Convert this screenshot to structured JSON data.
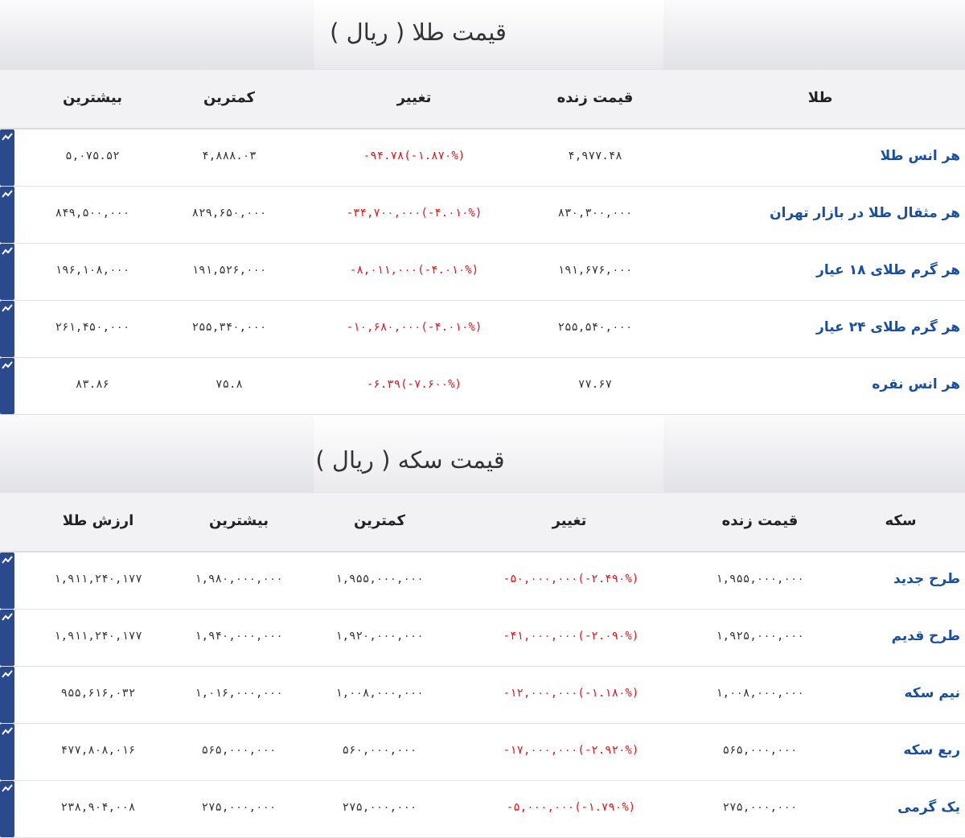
{
  "gold": {
    "title": "قیمت طلا ( ریال )",
    "headers": {
      "name": "طلا",
      "live": "قیمت زنده",
      "change": "تغییر",
      "low": "کمترین",
      "high": "بیشترین"
    },
    "rows": [
      {
        "name": "هر انس طلا",
        "live": "۴,۹۷۷.۴۸",
        "change": "-۹۴.۷۸(-۱.۸۷۰%)",
        "low": "۴,۸۸۸.۰۳",
        "high": "۵,۰۷۵.۵۲"
      },
      {
        "name": "هر مثقال طلا در بازار تهران",
        "live": "۸۳۰,۳۰۰,۰۰۰",
        "change": "-۳۴,۷۰۰,۰۰۰(-۴.۰۱۰%)",
        "low": "۸۲۹,۶۵۰,۰۰۰",
        "high": "۸۴۹,۵۰۰,۰۰۰"
      },
      {
        "name": "هر گرم طلای ۱۸ عیار",
        "live": "۱۹۱,۶۷۶,۰۰۰",
        "change": "-۸,۰۱۱,۰۰۰(-۴.۰۱۰%)",
        "low": "۱۹۱,۵۲۶,۰۰۰",
        "high": "۱۹۶,۱۰۸,۰۰۰"
      },
      {
        "name": "هر گرم طلای ۲۴ عیار",
        "live": "۲۵۵,۵۴۰,۰۰۰",
        "change": "-۱۰,۶۸۰,۰۰۰(-۴.۰۱۰%)",
        "low": "۲۵۵,۳۴۰,۰۰۰",
        "high": "۲۶۱,۴۵۰,۰۰۰"
      },
      {
        "name": "هر انس نقره",
        "live": "۷۷.۶۷",
        "change": "-۶.۳۹(-۷.۶۰۰%)",
        "low": "۷۵.۸",
        "high": "۸۳.۸۶"
      }
    ]
  },
  "coin": {
    "title": "قیمت سکه ( ریال )",
    "headers": {
      "name": "سکه",
      "live": "قیمت زنده",
      "change": "تغییر",
      "low": "کمترین",
      "high": "بیشترین",
      "gold_value": "ارزش طلا"
    },
    "rows": [
      {
        "name": "طرح جدید",
        "live": "۱,۹۵۵,۰۰۰,۰۰۰",
        "change": "-۵۰,۰۰۰,۰۰۰(-۲.۴۹۰%)",
        "low": "۱,۹۵۵,۰۰۰,۰۰۰",
        "high": "۱,۹۸۰,۰۰۰,۰۰۰",
        "gold_value": "۱,۹۱۱,۲۴۰,۱۷۷"
      },
      {
        "name": "طرح قدیم",
        "live": "۱,۹۲۵,۰۰۰,۰۰۰",
        "change": "-۴۱,۰۰۰,۰۰۰(-۲.۰۹۰%)",
        "low": "۱,۹۲۰,۰۰۰,۰۰۰",
        "high": "۱,۹۴۰,۰۰۰,۰۰۰",
        "gold_value": "۱,۹۱۱,۲۴۰,۱۷۷"
      },
      {
        "name": "نیم سکه",
        "live": "۱,۰۰۸,۰۰۰,۰۰۰",
        "change": "-۱۲,۰۰۰,۰۰۰(-۱.۱۸۰%)",
        "low": "۱,۰۰۸,۰۰۰,۰۰۰",
        "high": "۱,۰۱۶,۰۰۰,۰۰۰",
        "gold_value": "۹۵۵,۶۱۶,۰۳۲"
      },
      {
        "name": "ربع سکه",
        "live": "۵۶۵,۰۰۰,۰۰۰",
        "change": "-۱۷,۰۰۰,۰۰۰(-۲.۹۲۰%)",
        "low": "۵۶۰,۰۰۰,۰۰۰",
        "high": "۵۶۵,۰۰۰,۰۰۰",
        "gold_value": "۴۷۷,۸۰۸,۰۱۶"
      },
      {
        "name": "یک گرمی",
        "live": "۲۷۵,۰۰۰,۰۰۰",
        "change": "-۵,۰۰۰,۰۰۰(-۱.۷۹۰%)",
        "low": "۲۷۵,۰۰۰,۰۰۰",
        "high": "۲۷۵,۰۰۰,۰۰۰",
        "gold_value": "۲۳۸,۹۰۴,۰۰۸"
      }
    ]
  },
  "icons": {
    "row_icon": "chart-icon"
  },
  "colors": {
    "name_link": "#1a4f9c",
    "negative": "#e0151e",
    "icon_bg": "#2b4a8e"
  }
}
